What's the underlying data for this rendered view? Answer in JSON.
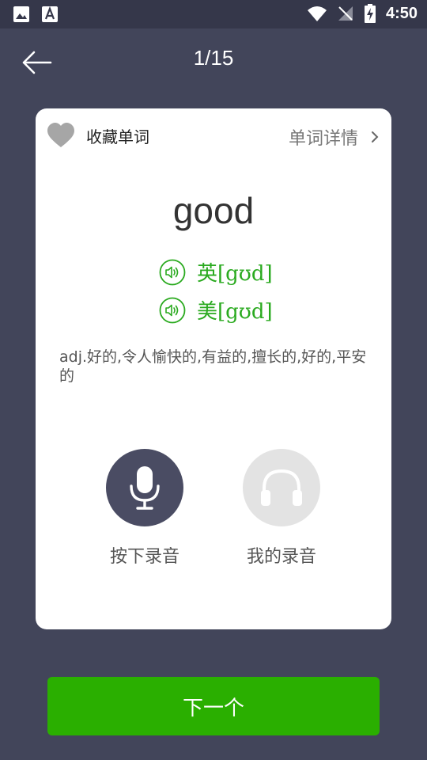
{
  "status_bar": {
    "time": "4:50"
  },
  "header": {
    "title": "1/15"
  },
  "card": {
    "favorite_label": "收藏单词",
    "detail_label": "单词详情",
    "word": "good",
    "pronunciations": [
      {
        "label": "英[gʊd]"
      },
      {
        "label": "美[gʊd]"
      }
    ],
    "definition": "adj.好的,令人愉快的,有益的,擅长的,好的,平安的",
    "record_label": "按下录音",
    "my_recording_label": "我的录音"
  },
  "footer": {
    "next_label": "下一个"
  },
  "colors": {
    "background": "#42455a",
    "accent_green": "#2aaf00",
    "pronunciation_green": "#2aaa1f",
    "mic_button": "#4a4c63",
    "headphone_button": "#e3e3e3"
  }
}
